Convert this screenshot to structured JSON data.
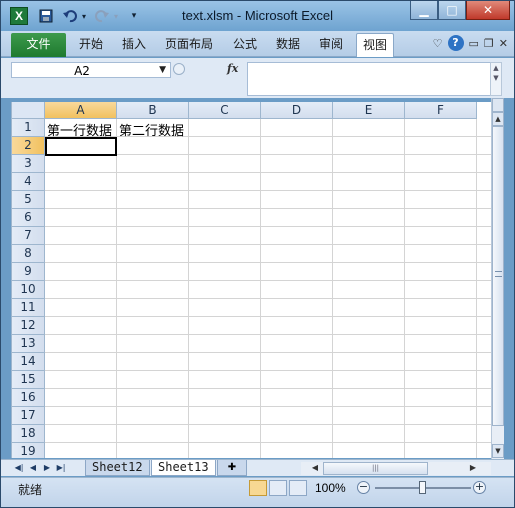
{
  "window": {
    "title": "text.xlsm - Microsoft Excel",
    "app_icon": "X",
    "qat_icons": [
      "save-icon",
      "undo-icon",
      "redo-icon",
      "customize-icon"
    ]
  },
  "ribbon": {
    "file_tab": "文件",
    "tabs": [
      "开始",
      "插入",
      "页面布局",
      "公式",
      "数据",
      "审阅",
      "视图"
    ],
    "active_tab": "视图"
  },
  "formula_bar": {
    "name_box": "A2",
    "fx_label": "fx",
    "formula": ""
  },
  "sheet": {
    "columns": [
      "A",
      "B",
      "C",
      "D",
      "E",
      "F"
    ],
    "rows": [
      "1",
      "2",
      "3",
      "4",
      "5",
      "6",
      "7",
      "8",
      "9",
      "10",
      "11",
      "12",
      "13",
      "14",
      "15",
      "16",
      "17",
      "18",
      "19"
    ],
    "selected_column": "A",
    "selected_row": "2",
    "cells": {
      "A1": "第一行数据",
      "B1": "第二行数据"
    }
  },
  "sheet_tabs": {
    "tabs": [
      "Sheet12",
      "Sheet13"
    ],
    "active": "Sheet13"
  },
  "status_bar": {
    "status": "就绪",
    "zoom": "100%",
    "zoom_level": 1.0
  },
  "colors": {
    "file_tab": "#1e7a2f",
    "header_selected": "#f1c15f",
    "window_frame": "#6b9cc6"
  }
}
